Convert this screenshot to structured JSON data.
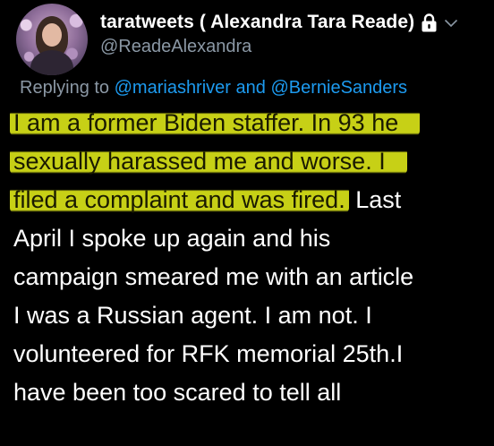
{
  "profile": {
    "display_name": "taratweets ( Alexandra Tara Reade)",
    "handle": "@ReadeAlexandra",
    "lock_icon": "lock-icon",
    "chevron_icon": "chevron-down-icon",
    "avatar_icon": "avatar"
  },
  "reply": {
    "prefix": "Replying to",
    "mention_1": "@mariashriver",
    "joiner": "and",
    "mention_2": "@BernieSanders"
  },
  "tweet": {
    "lines": [
      {
        "highlighted": "I am a former Biden staffer. In 93 he",
        "rest": ""
      },
      {
        "highlighted": "sexually harassed me and worse. I",
        "rest": ""
      },
      {
        "highlighted": "filed a complaint and was fired.",
        "rest": " Last"
      },
      {
        "highlighted": "",
        "rest": "April I spoke up again and his"
      },
      {
        "highlighted": "",
        "rest": "campaign smeared me with an article"
      },
      {
        "highlighted": "",
        "rest": "I was a Russian agent. I am not. I"
      },
      {
        "highlighted": "",
        "rest": "volunteered for RFK memorial 25th.I"
      },
      {
        "highlighted": "",
        "rest": "have been too scared to tell all"
      }
    ]
  },
  "colors": {
    "background": "#000000",
    "secondary_text": "#8b98a5",
    "mention": "#1d9bf0",
    "highlight": "#d6e018"
  }
}
